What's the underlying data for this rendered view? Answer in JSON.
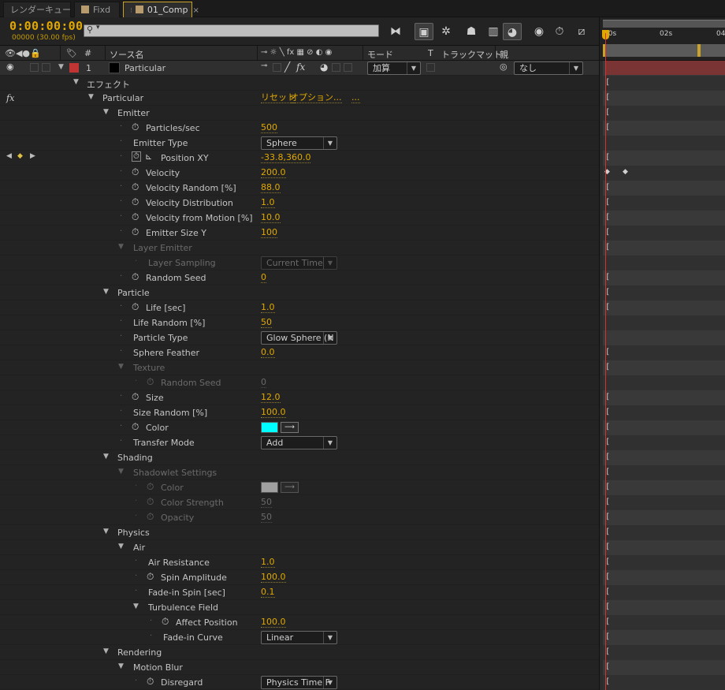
{
  "tabs": [
    {
      "label": "レンダーキュー",
      "active": false
    },
    {
      "label": "Fixd",
      "active": false
    },
    {
      "label": "01_Comp",
      "active": true,
      "close": "×"
    }
  ],
  "toolbar": {
    "timecode": "0:00:00:00",
    "fps": "00000 (30.00 fps)",
    "search_placeholder": ""
  },
  "columns": {
    "number": "#",
    "source_name": "ソース名",
    "mode": "モード",
    "t": "T",
    "trackmatte": "トラックマット",
    "parent": "親"
  },
  "layer": {
    "index": "1",
    "name": "Particular",
    "label_color": "#c03434",
    "mode": "加算",
    "parent": "なし"
  },
  "effects_group": "エフェクト",
  "effect": {
    "fx_label": "fx",
    "name": "Particular",
    "reset": "リセット",
    "options": "オプション...",
    "more": "..."
  },
  "rows": {
    "emitter": "Emitter",
    "particles_sec": {
      "label": "Particles/sec",
      "value": "500"
    },
    "emitter_type": {
      "label": "Emitter Type",
      "value": "Sphere"
    },
    "position_xy": {
      "label": "Position XY",
      "value": "-33.8,360.0"
    },
    "velocity": {
      "label": "Velocity",
      "value": "200.0"
    },
    "velocity_random": {
      "label": "Velocity Random [%]",
      "value": "88.0"
    },
    "velocity_distribution": {
      "label": "Velocity Distribution",
      "value": "1.0"
    },
    "velocity_from_motion": {
      "label": "Velocity from Motion [%]",
      "value": "10.0"
    },
    "emitter_size_y": {
      "label": "Emitter Size Y",
      "value": "100"
    },
    "layer_emitter": "Layer Emitter",
    "layer_sampling": {
      "label": "Layer Sampling",
      "value": "Current Time"
    },
    "random_seed": {
      "label": "Random Seed",
      "value": "0"
    },
    "particle": "Particle",
    "life": {
      "label": "Life [sec]",
      "value": "1.0"
    },
    "life_random": {
      "label": "Life Random [%]",
      "value": "50"
    },
    "particle_type": {
      "label": "Particle Type",
      "value": "Glow Sphere (N"
    },
    "sphere_feather": {
      "label": "Sphere Feather",
      "value": "0.0"
    },
    "texture": "Texture",
    "texture_random_seed": {
      "label": "Random Seed",
      "value": "0"
    },
    "size": {
      "label": "Size",
      "value": "12.0"
    },
    "size_random": {
      "label": "Size Random [%]",
      "value": "100.0"
    },
    "color": {
      "label": "Color",
      "value": "#00ffff"
    },
    "transfer_mode": {
      "label": "Transfer Mode",
      "value": "Add"
    },
    "shading": "Shading",
    "shadowlet_settings": "Shadowlet Settings",
    "shadow_color": {
      "label": "Color",
      "value": "#a0a0a0"
    },
    "color_strength": {
      "label": "Color Strength",
      "value": "50"
    },
    "opacity": {
      "label": "Opacity",
      "value": "50"
    },
    "physics": "Physics",
    "air": "Air",
    "air_resistance": {
      "label": "Air Resistance",
      "value": "1.0"
    },
    "spin_amplitude": {
      "label": "Spin Amplitude",
      "value": "100.0"
    },
    "fade_in_spin": {
      "label": "Fade-in Spin [sec]",
      "value": "0.1"
    },
    "turbulence_field": "Turbulence Field",
    "affect_position": {
      "label": "Affect Position",
      "value": "100.0"
    },
    "fade_in_curve": {
      "label": "Fade-in Curve",
      "value": "Linear"
    },
    "rendering": "Rendering",
    "motion_blur": "Motion Blur",
    "disregard": {
      "label": "Disregard",
      "value": "Physics Time F"
    }
  },
  "timeline": {
    "ticks": [
      "00s",
      "02s",
      "04"
    ]
  },
  "icons": {
    "stopwatch": "stopwatch-icon",
    "eye": "eye-icon",
    "triangle_open": "triangle-down-icon",
    "triangle_closed": "triangle-right-icon"
  },
  "colors": {
    "timecode": "#e0a800",
    "value": "#e0a800",
    "active_tab_border": "#c9a227",
    "cti": "#d63030",
    "layer_bar": "#7a3434"
  }
}
